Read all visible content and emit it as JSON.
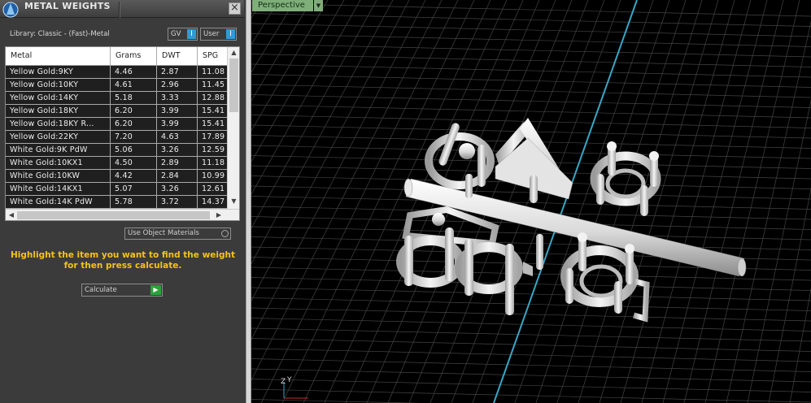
{
  "panel": {
    "title": "METAL WEIGHTS",
    "close_glyph": "×",
    "library_label": "Library: Classic - (Fast)-Metal",
    "toggle_gv": "GV",
    "toggle_user": "User",
    "toggle_glyph": "I",
    "use_object_materials": "Use Object Materials",
    "hint_line1": "Highlight the item you want to find the weight",
    "hint_line2": "for then press calculate.",
    "calculate_label": "Calculate",
    "calculate_glyph": "▶"
  },
  "table": {
    "columns": [
      "Metal",
      "Grams",
      "DWT",
      "SPG"
    ],
    "rows": [
      [
        "Yellow Gold:9KY",
        "4.46",
        "2.87",
        "11.08"
      ],
      [
        "Yellow Gold:10KY",
        "4.61",
        "2.96",
        "11.45"
      ],
      [
        "Yellow Gold:14KY",
        "5.18",
        "3.33",
        "12.88"
      ],
      [
        "Yellow Gold:18KY",
        "6.20",
        "3.99",
        "15.41"
      ],
      [
        "Yellow Gold:18KY R...",
        "6.20",
        "3.99",
        "15.41"
      ],
      [
        "Yellow Gold:22KY",
        "7.20",
        "4.63",
        "17.89"
      ],
      [
        "White Gold:9K PdW",
        "5.06",
        "3.26",
        "12.59"
      ],
      [
        "White Gold:10KX1",
        "4.50",
        "2.89",
        "11.18"
      ],
      [
        "White Gold:10KW",
        "4.42",
        "2.84",
        "10.99"
      ],
      [
        "White Gold:14KX1",
        "5.07",
        "3.26",
        "12.61"
      ],
      [
        "White Gold:14K PdW",
        "5.78",
        "3.72",
        "14.37"
      ]
    ],
    "scroll_up": "▲",
    "scroll_down": "▼",
    "scroll_left": "◀",
    "scroll_right": "▶"
  },
  "viewport": {
    "view_label": "Perspective",
    "view_dropdown_glyph": "▼",
    "axis_z": "Z",
    "axis_y": "Y"
  },
  "colors": {
    "panel_bg": "#3b3b3b",
    "hint_yellow": "#f3c31a",
    "toggle_blue": "#2f9bd6",
    "calc_green": "#2aa33a",
    "viewport_tab": "#7fae7a",
    "grid_line": "#444444",
    "axis_cyan": "#3aa6c4"
  },
  "icons": {
    "panel_logo": "gemvision-logo-icon",
    "close": "close-icon",
    "calculate": "play-icon"
  }
}
